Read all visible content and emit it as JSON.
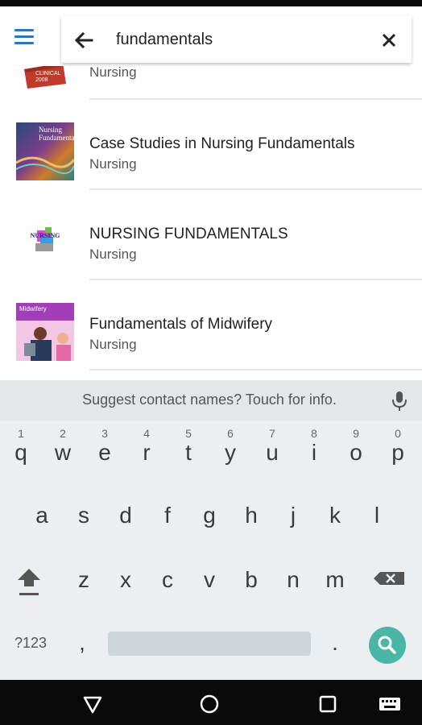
{
  "search": {
    "query": "fundamentals"
  },
  "results": [
    {
      "title": "",
      "subtitle": "Nursing",
      "cover_text": "CLINICAL 2008"
    },
    {
      "title": "Case Studies in Nursing Fundamentals",
      "subtitle": "Nursing",
      "cover_text": "Nursing Fundamentals"
    },
    {
      "title": "NURSING FUNDAMENTALS",
      "subtitle": "Nursing",
      "cover_text": "NURSING FUNDAMENTALS"
    },
    {
      "title": "Fundamentals of Midwifery",
      "subtitle": "Nursing",
      "cover_text": "Midwifery"
    }
  ],
  "keyboard": {
    "suggestion": "Suggest contact names? Touch for info.",
    "row1": [
      {
        "key": "q",
        "hint": "1"
      },
      {
        "key": "w",
        "hint": "2"
      },
      {
        "key": "e",
        "hint": "3"
      },
      {
        "key": "r",
        "hint": "4"
      },
      {
        "key": "t",
        "hint": "5"
      },
      {
        "key": "y",
        "hint": "6"
      },
      {
        "key": "u",
        "hint": "7"
      },
      {
        "key": "i",
        "hint": "8"
      },
      {
        "key": "o",
        "hint": "9"
      },
      {
        "key": "p",
        "hint": "0"
      }
    ],
    "row2": [
      "a",
      "s",
      "d",
      "f",
      "g",
      "h",
      "j",
      "k",
      "l"
    ],
    "row3": [
      "z",
      "x",
      "c",
      "v",
      "b",
      "n",
      "m"
    ],
    "symbols_label": "?123",
    "comma": ",",
    "period": "."
  },
  "colors": {
    "accent": "#2f73b8",
    "search_key": "#4bb5a6",
    "keyboard_bg": "#eceff1"
  },
  "icons": {
    "menu": "hamburger-icon",
    "back": "arrow-left-icon",
    "clear": "close-icon",
    "mic": "microphone-icon",
    "shift": "shift-icon",
    "backspace": "backspace-icon",
    "search": "search-icon",
    "nav_back": "triangle-back-icon",
    "nav_home": "circle-home-icon",
    "nav_recents": "square-recents-icon",
    "nav_keyboard": "keyboard-icon"
  }
}
